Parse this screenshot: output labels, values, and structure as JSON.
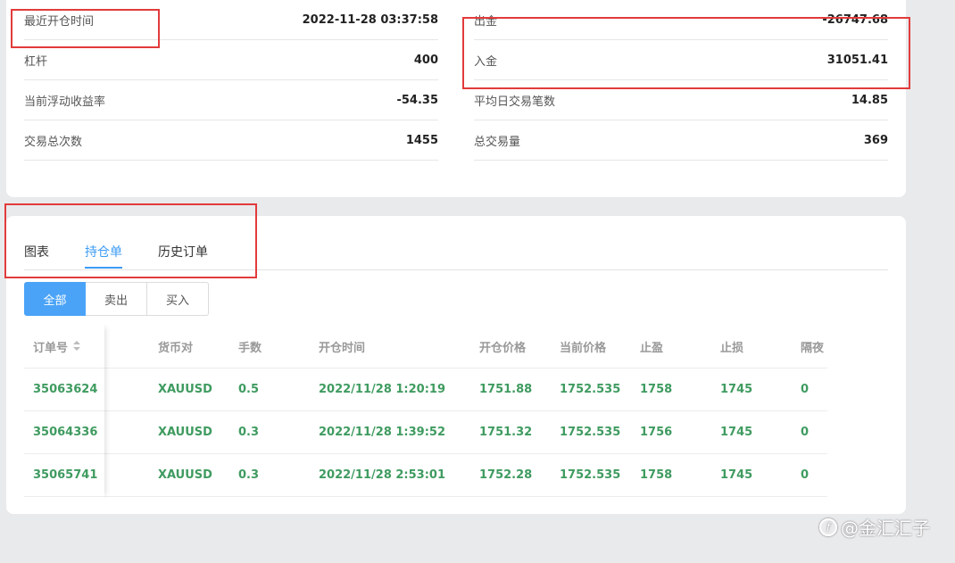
{
  "stats": {
    "left": [
      {
        "label": "最近开仓时间",
        "value": "2022-11-28 03:37:58"
      },
      {
        "label": "杠杆",
        "value": "400"
      },
      {
        "label": "当前浮动收益率",
        "value": "-54.35"
      },
      {
        "label": "交易总次数",
        "value": "1455"
      }
    ],
    "right": [
      {
        "label": "出金",
        "value": "-26747.68"
      },
      {
        "label": "入金",
        "value": "31051.41"
      },
      {
        "label": "平均日交易笔数",
        "value": "14.85"
      },
      {
        "label": "总交易量",
        "value": "369"
      }
    ]
  },
  "tabs": [
    {
      "label": "图表"
    },
    {
      "label": "持仓单"
    },
    {
      "label": "历史订单"
    }
  ],
  "filter": {
    "all": "全部",
    "sell": "卖出",
    "buy": "买入"
  },
  "table": {
    "headers": {
      "order_no": "订单号",
      "pair": "货币对",
      "lots": "手数",
      "open_time": "开仓时间",
      "open_price": "开仓价格",
      "current_price": "当前价格",
      "take_profit": "止盈",
      "stop_loss": "止损",
      "overnight": "隔夜"
    },
    "rows": [
      {
        "order_no": "35063624",
        "pair": "XAUUSD",
        "lots": "0.5",
        "open_time": "2022/11/28 1:20:19",
        "open_price": "1751.88",
        "current_price": "1752.535",
        "take_profit": "1758",
        "stop_loss": "1745",
        "overnight": "0"
      },
      {
        "order_no": "35064336",
        "pair": "XAUUSD",
        "lots": "0.3",
        "open_time": "2022/11/28 1:39:52",
        "open_price": "1751.32",
        "current_price": "1752.535",
        "take_profit": "1756",
        "stop_loss": "1745",
        "overnight": "0"
      },
      {
        "order_no": "35065741",
        "pair": "XAUUSD",
        "lots": "0.3",
        "open_time": "2022/11/28 2:53:01",
        "open_price": "1752.28",
        "current_price": "1752.535",
        "take_profit": "1758",
        "stop_loss": "1745",
        "overnight": "0"
      }
    ]
  },
  "watermark": {
    "logo": "f",
    "text": "@金汇汇子"
  },
  "colors": {
    "accent": "#3d9cf5",
    "profit_green": "#3f9b60",
    "annotation_red": "#e23b3b"
  }
}
